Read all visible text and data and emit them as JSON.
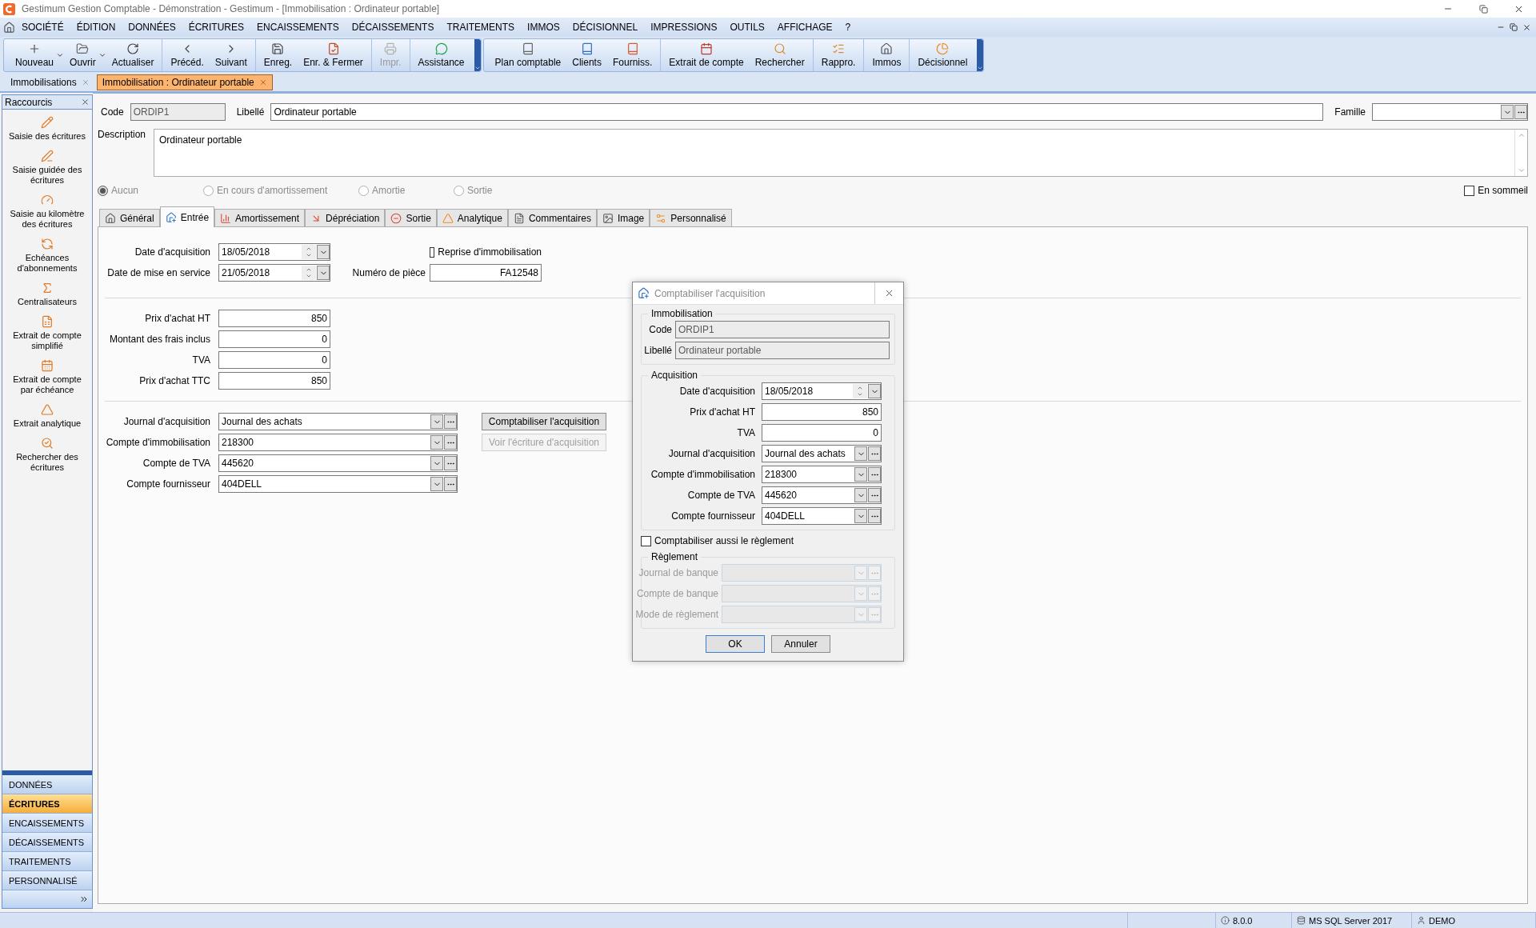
{
  "window": {
    "title": "Gestimum Gestion Comptable - Démonstration - Gestimum - [Immobilisation : Ordinateur portable]"
  },
  "menu": [
    "SOCIÉTÉ",
    "ÉDITION",
    "DONNÉES",
    "ÉCRITURES",
    "ENCAISSEMENTS",
    "DÉCAISSEMENTS",
    "TRAITEMENTS",
    "IMMOS",
    "DÉCISIONNEL",
    "IMPRESSIONS",
    "OUTILS",
    "AFFICHAGE",
    "?"
  ],
  "toolbars": [
    {
      "groups": [
        {
          "items": [
            {
              "label": "Nouveau",
              "dropdown": true,
              "disabled": false
            },
            {
              "label": "Ouvrir",
              "dropdown": true,
              "disabled": false
            },
            {
              "label": "Actualiser",
              "dropdown": false,
              "disabled": false
            }
          ]
        },
        {
          "items": [
            {
              "label": "Précéd.",
              "dropdown": false,
              "disabled": false
            },
            {
              "label": "Suivant",
              "dropdown": false,
              "disabled": false
            }
          ]
        },
        {
          "items": [
            {
              "label": "Enreg.",
              "dropdown": false,
              "disabled": false
            },
            {
              "label": "Enr. & Fermer",
              "dropdown": false,
              "disabled": false
            }
          ]
        },
        {
          "items": [
            {
              "label": "Impr.",
              "dropdown": false,
              "disabled": true
            }
          ]
        },
        {
          "items": [
            {
              "label": "Assistance",
              "dropdown": false,
              "disabled": false
            }
          ]
        }
      ]
    },
    {
      "groups": [
        {
          "items": [
            {
              "label": "Plan comptable",
              "dropdown": false,
              "disabled": false
            },
            {
              "label": "Clients",
              "dropdown": false,
              "disabled": false
            },
            {
              "label": "Fourniss.",
              "dropdown": false,
              "disabled": false
            }
          ]
        },
        {
          "items": [
            {
              "label": "Extrait de compte",
              "dropdown": false,
              "disabled": false
            },
            {
              "label": "Rechercher",
              "dropdown": false,
              "disabled": false
            }
          ]
        },
        {
          "items": [
            {
              "label": "Rappro.",
              "dropdown": false,
              "disabled": false
            }
          ]
        },
        {
          "items": [
            {
              "label": "Immos",
              "dropdown": false,
              "disabled": false
            }
          ]
        },
        {
          "items": [
            {
              "label": "Décisionnel",
              "dropdown": false,
              "disabled": false
            }
          ]
        }
      ]
    }
  ],
  "doc_tabs": [
    {
      "label": "Immobilisations",
      "selected": false
    },
    {
      "label": "Immobilisation : Ordinateur portable",
      "selected": true
    }
  ],
  "sidebar": {
    "title": "Raccourcis",
    "shortcuts": [
      "Saisie des écritures",
      "Saisie guidée des écritures",
      "Saisie au kilomètre des écritures",
      "Echéances d'abonnements",
      "Centralisateurs",
      "Extrait de compte simplifié",
      "Extrait de compte par échéance",
      "Extrait analytique",
      "Rechercher des écritures"
    ],
    "sections": [
      {
        "label": "DONNÉES",
        "selected": false
      },
      {
        "label": "ÉCRITURES",
        "selected": true
      },
      {
        "label": "ENCAISSEMENTS",
        "selected": false
      },
      {
        "label": "DÉCAISSEMENTS",
        "selected": false
      },
      {
        "label": "TRAITEMENTS",
        "selected": false
      },
      {
        "label": "PERSONNALISÉ",
        "selected": false
      }
    ]
  },
  "form": {
    "code": {
      "label": "Code",
      "value": "ORDIP1"
    },
    "libelle": {
      "label": "Libellé",
      "value": "Ordinateur portable"
    },
    "famille": {
      "label": "Famille"
    },
    "description": {
      "label": "Description",
      "value": "Ordinateur portable"
    },
    "status": [
      {
        "label": "Aucun",
        "selected": true
      },
      {
        "label": "En cours d'amortissement",
        "selected": false
      },
      {
        "label": "Amortie",
        "selected": false
      },
      {
        "label": "Sortie",
        "selected": false
      }
    ],
    "sleep": {
      "label": "En sommeil",
      "checked": false
    }
  },
  "tabs": [
    {
      "label": "Général",
      "selected": false
    },
    {
      "label": "Entrée",
      "selected": true
    },
    {
      "label": "Amortissement",
      "selected": false
    },
    {
      "label": "Dépréciation",
      "selected": false
    },
    {
      "label": "Sortie",
      "selected": false
    },
    {
      "label": "Analytique",
      "selected": false
    },
    {
      "label": "Commentaires",
      "selected": false
    },
    {
      "label": "Image",
      "selected": false
    },
    {
      "label": "Personnalisé",
      "selected": false
    }
  ],
  "entree": {
    "dates": [
      {
        "label": "Date d'acquisition",
        "value": "18/05/2018"
      },
      {
        "label": "Date de mise en service",
        "value": "21/05/2018"
      }
    ],
    "reprise": {
      "label": "Reprise d'immobilisation",
      "checked": false
    },
    "piece": {
      "label": "Numéro de pièce",
      "value": "FA12548"
    },
    "amounts": [
      {
        "label": "Prix d'achat HT",
        "value": "850"
      },
      {
        "label": "Montant des frais inclus",
        "value": "0"
      },
      {
        "label": "TVA",
        "value": "0"
      },
      {
        "label": "Prix d'achat TTC",
        "value": "850"
      }
    ],
    "accounts": [
      {
        "label": "Journal d'acquisition",
        "value": "Journal des achats"
      },
      {
        "label": "Compte d'immobilisation",
        "value": "218300"
      },
      {
        "label": "Compte de TVA",
        "value": "445620"
      },
      {
        "label": "Compte fournisseur",
        "value": "404DELL"
      }
    ],
    "actions": [
      {
        "label": "Comptabiliser l'acquisition",
        "disabled": false
      },
      {
        "label": "Voir l'écriture d'acquisition",
        "disabled": true
      }
    ]
  },
  "dialog": {
    "title": "Comptabiliser l'acquisition",
    "asset_group": {
      "title": "Immobilisation",
      "fields": [
        {
          "label": "Code",
          "value": "ORDIP1"
        },
        {
          "label": "Libellé",
          "value": "Ordinateur portable"
        }
      ]
    },
    "acquisition_group": {
      "title": "Acquisition",
      "fields": [
        {
          "kind": "date",
          "label": "Date d'acquisition",
          "value": "18/05/2018"
        },
        {
          "kind": "amount",
          "label": "Prix d'achat HT",
          "value": "850"
        },
        {
          "kind": "amount",
          "label": "TVA",
          "value": "0"
        },
        {
          "kind": "combo",
          "label": "Journal d'acquisition",
          "value": "Journal des achats"
        },
        {
          "kind": "combo",
          "label": "Compte d'immobilisation",
          "value": "218300"
        },
        {
          "kind": "combo",
          "label": "Compte de TVA",
          "value": "445620"
        },
        {
          "kind": "combo",
          "label": "Compte fournisseur",
          "value": "404DELL"
        }
      ]
    },
    "pay_too": {
      "label": "Comptabiliser aussi le règlement",
      "checked": false
    },
    "payment_group": {
      "title": "Règlement",
      "disabled": true,
      "fields": [
        {
          "label": "Journal de banque"
        },
        {
          "label": "Compte de banque"
        },
        {
          "label": "Mode de règlement"
        }
      ]
    },
    "buttons": [
      {
        "label": "OK",
        "default": true
      },
      {
        "label": "Annuler",
        "default": false
      }
    ]
  },
  "status_bar": [
    "8.0.0",
    "MS SQL Server 2017",
    "DEMO"
  ]
}
